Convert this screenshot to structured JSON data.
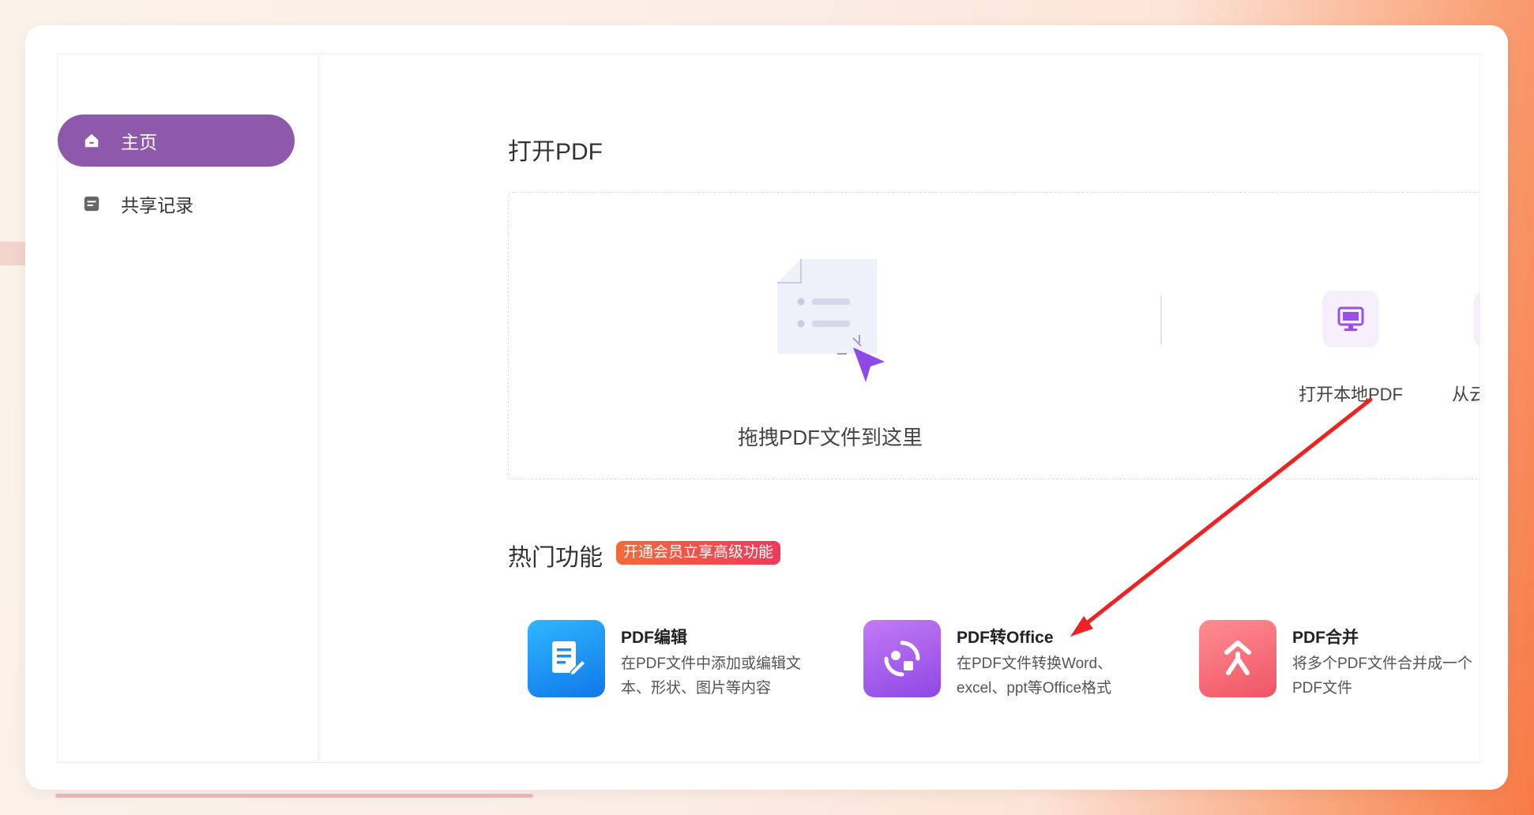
{
  "sidebar": {
    "items": [
      {
        "label": "主页",
        "icon": "home-icon",
        "active": true
      },
      {
        "label": "共享记录",
        "icon": "share-record-icon",
        "active": false
      }
    ]
  },
  "open_pdf": {
    "title": "打开PDF",
    "drop_text": "拖拽PDF文件到这里",
    "open_local_label": "打开本地PDF",
    "open_cloud_label": "从云"
  },
  "hot_features": {
    "title": "热门功能",
    "promo_badge": "开通会员立享高级功能",
    "items": [
      {
        "name": "PDF编辑",
        "desc_line1": "在PDF文件中添加或编辑文",
        "desc_line2": "本、形状、图片等内容",
        "icon": "pdf-edit-icon",
        "color": "#1d8ff0"
      },
      {
        "name": "PDF转Office",
        "desc_line1": "在PDF文件转换Word、",
        "desc_line2": "excel、ppt等Office格式",
        "icon": "pdf-convert-icon",
        "color": "#a05de0"
      },
      {
        "name": "PDF合并",
        "desc_line1": "将多个PDF文件合并成一个",
        "desc_line2": "PDF文件",
        "icon": "pdf-merge-icon",
        "color": "#f2656e"
      }
    ]
  },
  "colors": {
    "accent": "#8e59ab",
    "annotation_arrow": "#ee2222"
  }
}
